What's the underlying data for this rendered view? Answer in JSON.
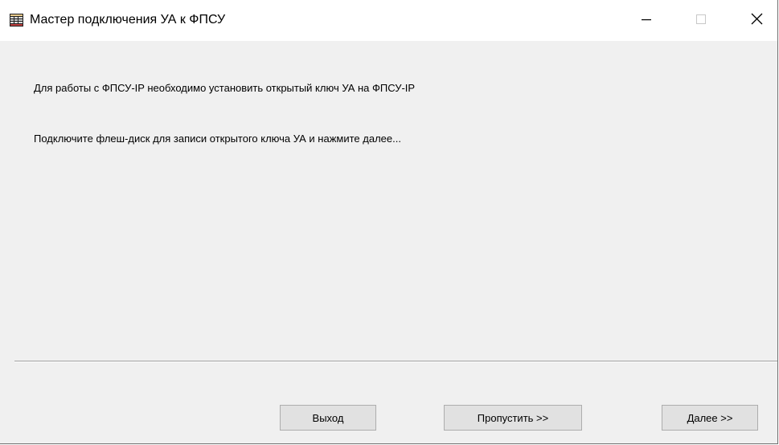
{
  "window": {
    "title": "Мастер подключения УА к ФПСУ",
    "icon": "grid-app-icon",
    "controls": {
      "minimize_icon": "minimize-icon",
      "maximize_icon": "maximize-icon",
      "close_icon": "close-icon"
    }
  },
  "content": {
    "message_1": "Для работы с ФПСУ-IP необходимо установить открытый ключ УА на ФПСУ-IP",
    "message_2": "Подключите флеш-диск для записи открытого ключа УА и нажмите далее..."
  },
  "buttons": {
    "exit_label": "Выход",
    "skip_label": "Пропустить >>",
    "next_label": "Далее >>"
  },
  "colors": {
    "window_bg": "#f0f0f0",
    "titlebar_bg": "#ffffff",
    "button_bg": "#e1e1e1",
    "button_border": "#adadad"
  }
}
